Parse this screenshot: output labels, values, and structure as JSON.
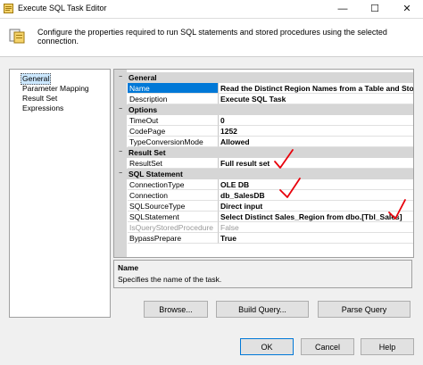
{
  "window": {
    "title": "Execute SQL Task Editor"
  },
  "header": {
    "text": "Configure the properties required to run SQL statements and stored procedures using the selected connection."
  },
  "nav": {
    "items": [
      "General",
      "Parameter Mapping",
      "Result Set",
      "Expressions"
    ],
    "selected": "General"
  },
  "properties": {
    "categories": {
      "general": "General",
      "options": "Options",
      "result_set": "Result Set",
      "sql_statement": "SQL Statement"
    },
    "rows": {
      "name": {
        "label": "Name",
        "value": "Read the Distinct Region Names from a Table and Store Ful"
      },
      "description": {
        "label": "Description",
        "value": "Execute SQL Task"
      },
      "timeout": {
        "label": "TimeOut",
        "value": "0"
      },
      "codepage": {
        "label": "CodePage",
        "value": "1252"
      },
      "type_conversion_mode": {
        "label": "TypeConversionMode",
        "value": "Allowed"
      },
      "result_set": {
        "label": "ResultSet",
        "value": "Full result set"
      },
      "connection_type": {
        "label": "ConnectionType",
        "value": "OLE DB"
      },
      "connection": {
        "label": "Connection",
        "value": "db_SalesDB"
      },
      "sql_source_type": {
        "label": "SQLSourceType",
        "value": "Direct input"
      },
      "sql_statement": {
        "label": "SQLStatement",
        "value": "Select Distinct Sales_Region from dbo.[Tbl_Sales]"
      },
      "is_query_stored_procedure": {
        "label": "IsQueryStoredProcedure",
        "value": "False"
      },
      "bypass_prepare": {
        "label": "BypassPrepare",
        "value": "True"
      }
    }
  },
  "description_panel": {
    "title": "Name",
    "text": "Specifies the name of the task."
  },
  "buttons": {
    "browse": "Browse...",
    "build_query": "Build Query...",
    "parse_query": "Parse Query",
    "ok": "OK",
    "cancel": "Cancel",
    "help": "Help"
  },
  "colors": {
    "selection": "#0078d7",
    "annotation": "#e8000b",
    "category_bg": "#d6d6d6"
  },
  "icons": [
    "app-icon",
    "minimize-icon",
    "maximize-icon",
    "close-icon",
    "task-icon"
  ]
}
